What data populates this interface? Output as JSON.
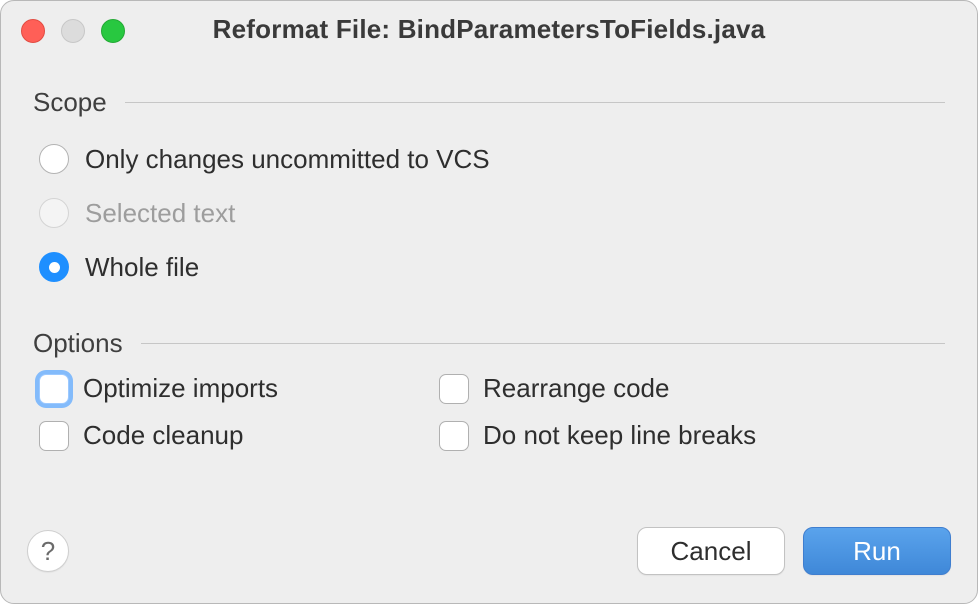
{
  "title": "Reformat File: BindParametersToFields.java",
  "sections": {
    "scope": {
      "label": "Scope",
      "options": [
        {
          "label": "Only changes uncommitted to VCS",
          "selected": false,
          "disabled": false
        },
        {
          "label": "Selected text",
          "selected": false,
          "disabled": true
        },
        {
          "label": "Whole file",
          "selected": true,
          "disabled": false
        }
      ]
    },
    "options": {
      "label": "Options",
      "checks": [
        {
          "label": "Optimize imports",
          "checked": false,
          "focused": true
        },
        {
          "label": "Rearrange code",
          "checked": false,
          "focused": false
        },
        {
          "label": "Code cleanup",
          "checked": false,
          "focused": false
        },
        {
          "label": "Do not keep line breaks",
          "checked": false,
          "focused": false
        }
      ]
    }
  },
  "buttons": {
    "help": "?",
    "cancel": "Cancel",
    "run": "Run"
  }
}
